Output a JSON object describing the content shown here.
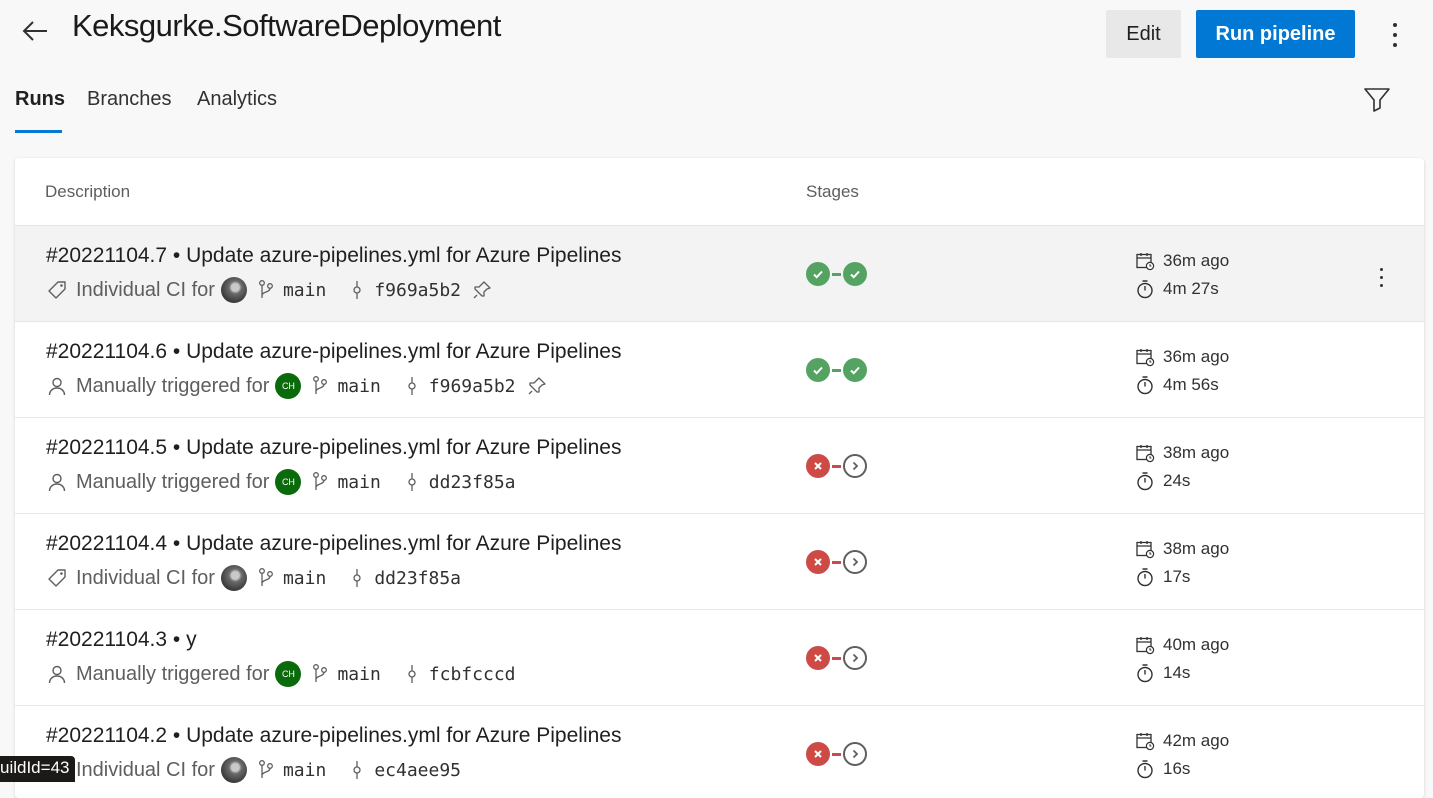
{
  "header": {
    "title": "Keksgurke.SoftwareDeployment",
    "edit_label": "Edit",
    "run_label": "Run pipeline"
  },
  "tabs": [
    {
      "label": "Runs",
      "active": true
    },
    {
      "label": "Branches",
      "active": false
    },
    {
      "label": "Analytics",
      "active": false
    }
  ],
  "table": {
    "col_description": "Description",
    "col_stages": "Stages"
  },
  "runs": [
    {
      "title": "#20221104.7 • Update azure-pipelines.yml for Azure Pipelines",
      "trigger": "Individual CI for",
      "trigger_icon": "tag-icon",
      "avatar": "image",
      "branch": "main",
      "commit": "f969a5b2",
      "pinned": true,
      "stages": [
        "success",
        "success"
      ],
      "started": "36m ago",
      "duration": "4m 27s"
    },
    {
      "title": "#20221104.6 • Update azure-pipelines.yml for Azure Pipelines",
      "trigger": "Manually triggered for",
      "trigger_icon": "person-icon",
      "avatar": "CH",
      "branch": "main",
      "commit": "f969a5b2",
      "pinned": true,
      "stages": [
        "success",
        "success"
      ],
      "started": "36m ago",
      "duration": "4m 56s"
    },
    {
      "title": "#20221104.5 • Update azure-pipelines.yml for Azure Pipelines",
      "trigger": "Manually triggered for",
      "trigger_icon": "person-icon",
      "avatar": "CH",
      "branch": "main",
      "commit": "dd23f85a",
      "pinned": false,
      "stages": [
        "failed",
        "skipped"
      ],
      "started": "38m ago",
      "duration": "24s"
    },
    {
      "title": "#20221104.4 • Update azure-pipelines.yml for Azure Pipelines",
      "trigger": "Individual CI for",
      "trigger_icon": "tag-icon",
      "avatar": "image",
      "branch": "main",
      "commit": "dd23f85a",
      "pinned": false,
      "stages": [
        "failed",
        "skipped"
      ],
      "started": "38m ago",
      "duration": "17s"
    },
    {
      "title": "#20221104.3 • y",
      "trigger": "Manually triggered for",
      "trigger_icon": "person-icon",
      "avatar": "CH",
      "branch": "main",
      "commit": "fcbfcccd",
      "pinned": false,
      "stages": [
        "failed",
        "skipped"
      ],
      "started": "40m ago",
      "duration": "14s"
    },
    {
      "title": "#20221104.2 • Update azure-pipelines.yml for Azure Pipelines",
      "trigger": "Individual CI for",
      "trigger_icon": "tag-icon",
      "avatar": "image",
      "branch": "main",
      "commit": "ec4aee95",
      "pinned": false,
      "stages": [
        "failed",
        "skipped"
      ],
      "started": "42m ago",
      "duration": "16s"
    }
  ],
  "status_tip": "uildId=43",
  "colors": {
    "accent": "#0078d4",
    "success": "#55a362",
    "failed": "#cd4a45"
  }
}
